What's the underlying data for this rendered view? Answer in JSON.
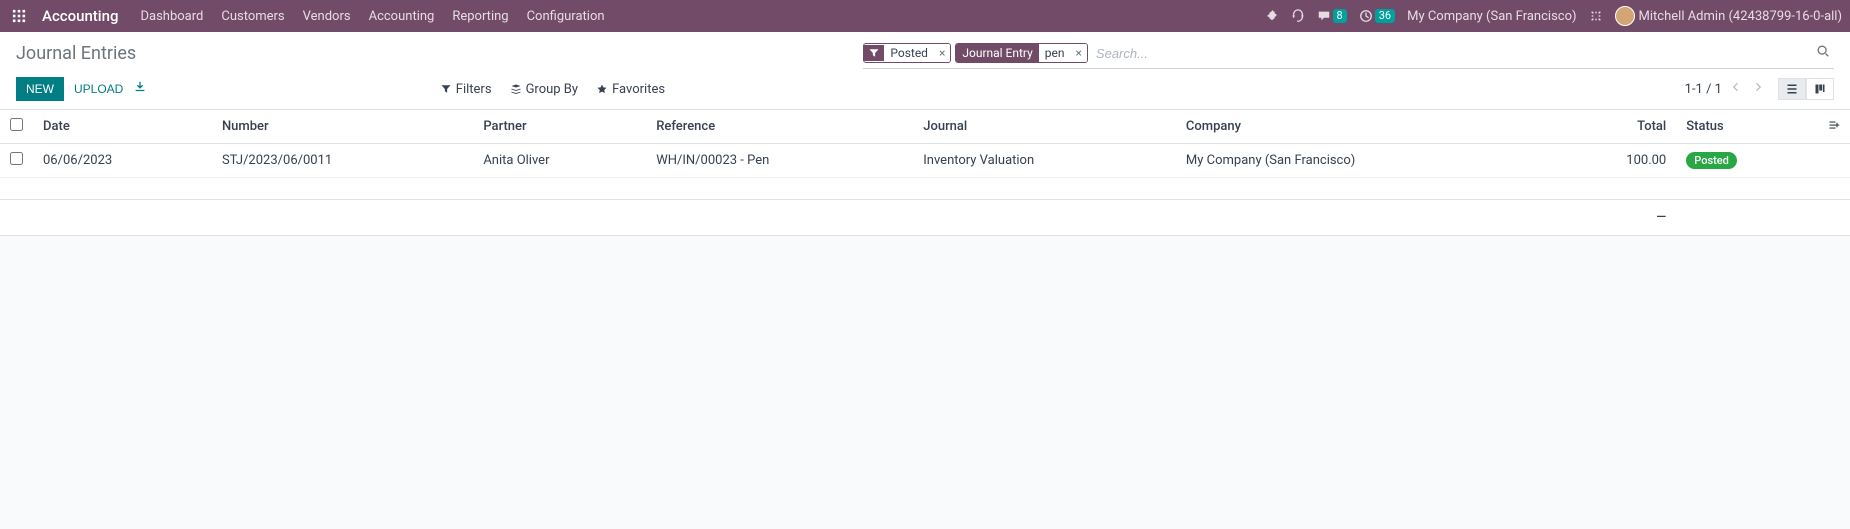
{
  "navbar": {
    "brand": "Accounting",
    "menu": [
      "Dashboard",
      "Customers",
      "Vendors",
      "Accounting",
      "Reporting",
      "Configuration"
    ],
    "msg_badge": "8",
    "activity_badge": "36",
    "company": "My Company (San Francisco)",
    "user": "Mitchell Admin (42438799-16-0-all)"
  },
  "breadcrumb": "Journal Entries",
  "search": {
    "facets": [
      {
        "type": "filter",
        "label": "Posted"
      },
      {
        "type": "field",
        "label": "Journal Entry",
        "value": "pen"
      }
    ],
    "placeholder": "Search..."
  },
  "actions": {
    "new": "NEW",
    "upload": "UPLOAD"
  },
  "filters": {
    "filters": "Filters",
    "groupby": "Group By",
    "favorites": "Favorites"
  },
  "pager": {
    "range": "1-1 / 1"
  },
  "columns": {
    "date": "Date",
    "number": "Number",
    "partner": "Partner",
    "reference": "Reference",
    "journal": "Journal",
    "company": "Company",
    "total": "Total",
    "status": "Status"
  },
  "rows": [
    {
      "date": "06/06/2023",
      "number": "STJ/2023/06/0011",
      "partner": "Anita Oliver",
      "reference": "WH/IN/00023 - Pen",
      "journal": "Inventory Valuation",
      "company": "My Company (San Francisco)",
      "total": "100.00",
      "status": "Posted"
    }
  ],
  "summary_total": "—"
}
